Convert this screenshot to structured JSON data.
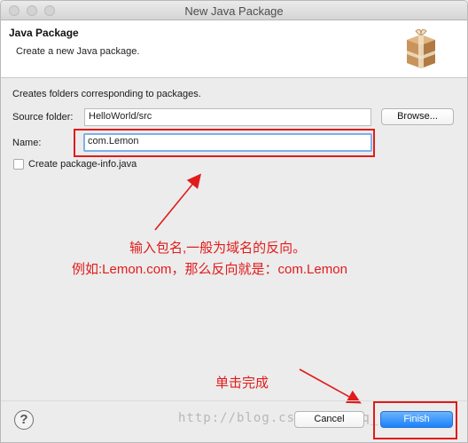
{
  "window": {
    "title": "New Java Package"
  },
  "banner": {
    "title": "Java Package",
    "description": "Create a new Java package."
  },
  "form": {
    "hint": "Creates folders corresponding to packages.",
    "source_folder_label": "Source folder:",
    "source_folder_value": "HelloWorld/src",
    "browse_label": "Browse...",
    "name_label": "Name:",
    "name_value": "com.Lemon",
    "create_package_info_label": "Create package-info.java",
    "create_package_info_checked": false
  },
  "annotations": {
    "line1": "输入包名,一般为域名的反向。",
    "line2": "例如:Lemon.com，那么反向就是：com.Lemon",
    "finish_hint": "单击完成",
    "color": "#e11b1b"
  },
  "footer": {
    "cancel_label": "Cancel",
    "finish_label": "Finish",
    "help_label": "?"
  },
  "watermark": "http://blog.csdn.net/qq_15096713"
}
